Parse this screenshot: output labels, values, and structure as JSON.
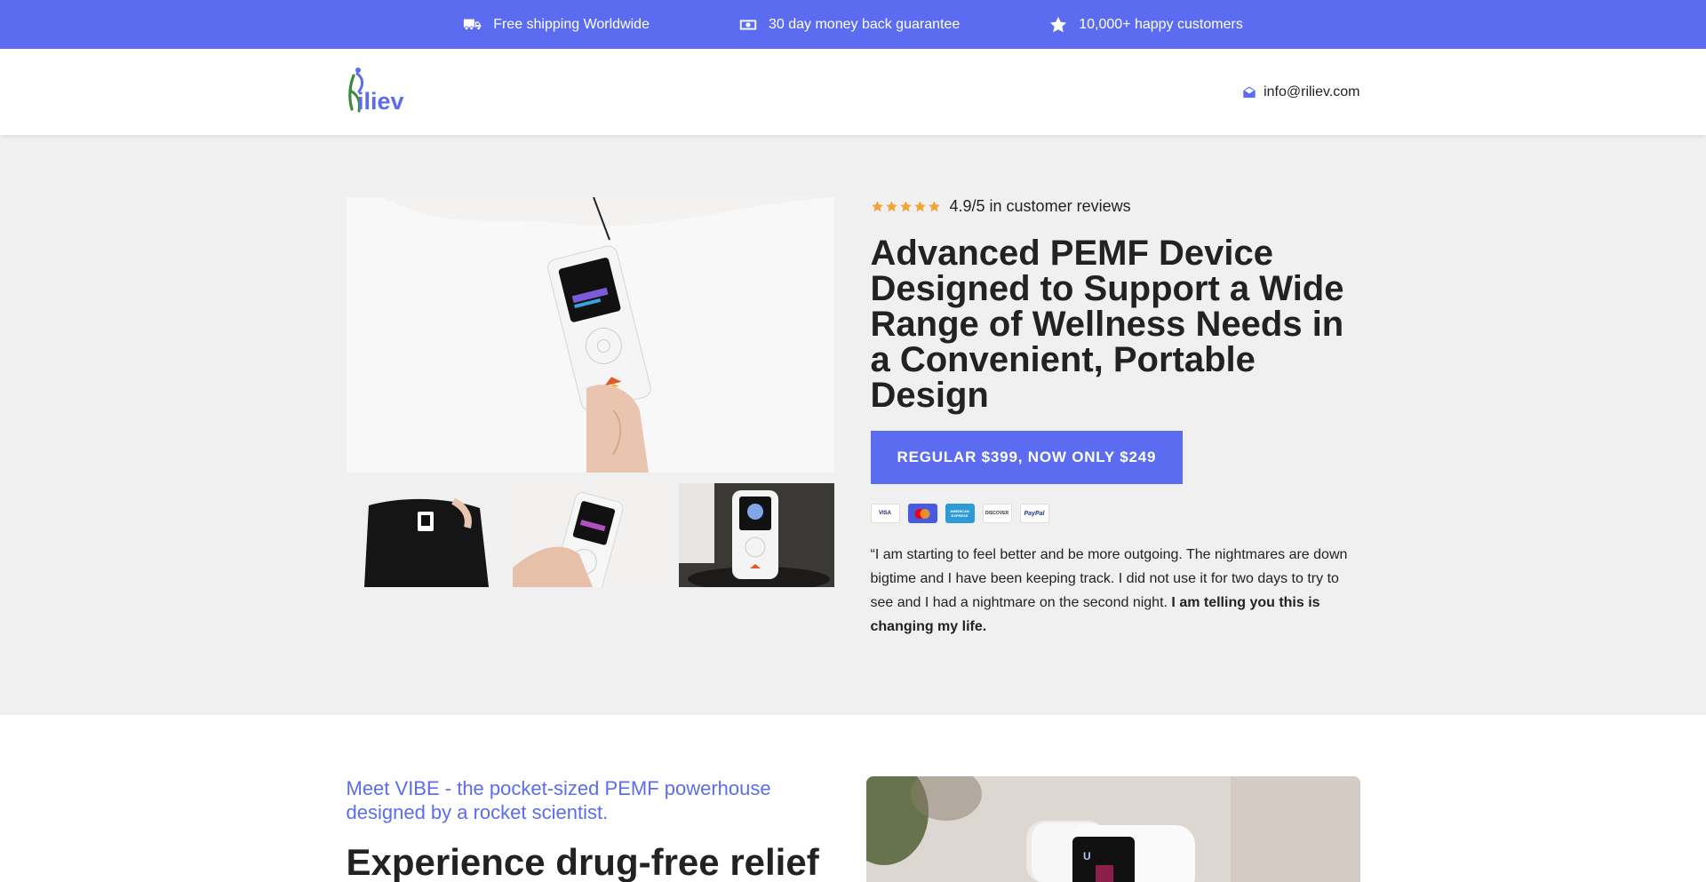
{
  "promo_bar": {
    "items": [
      {
        "icon": "truck-icon",
        "text": "Free shipping Worldwide"
      },
      {
        "icon": "money-icon",
        "text": "30 day money back guarantee"
      },
      {
        "icon": "star-icon",
        "text": "10,000+ happy customers"
      }
    ]
  },
  "header": {
    "logo_text": "Riliev",
    "email": "info@riliev.com"
  },
  "hero": {
    "rating_text": "4.9/5 in customer reviews",
    "title": "Advanced PEMF Device Designed to Support a Wide Range of Wellness Needs in a Convenient, Portable Design",
    "cta_label": "REGULAR $399, NOW ONLY $249",
    "payment_methods": [
      "VISA",
      "Mastercard",
      "AMERICAN EXPRESS",
      "DISCOVER",
      "PayPal"
    ],
    "testimonial_plain": "“I am starting to feel better and be more outgoing. The nightmares are down bigtime and I have been keeping track. I did not use it for two days to try to see and I had a nightmare on the second night.",
    "testimonial_bold": "I am telling you this is changing my life."
  },
  "features": {
    "subtitle": "Meet VIBE - the pocket-sized PEMF powerhouse designed by a rocket scientist.",
    "heading": "Experience drug-free relief"
  },
  "colors": {
    "accent": "#5b6cf0",
    "star": "#f0a23b",
    "hero_bg": "#f0f0f0"
  }
}
